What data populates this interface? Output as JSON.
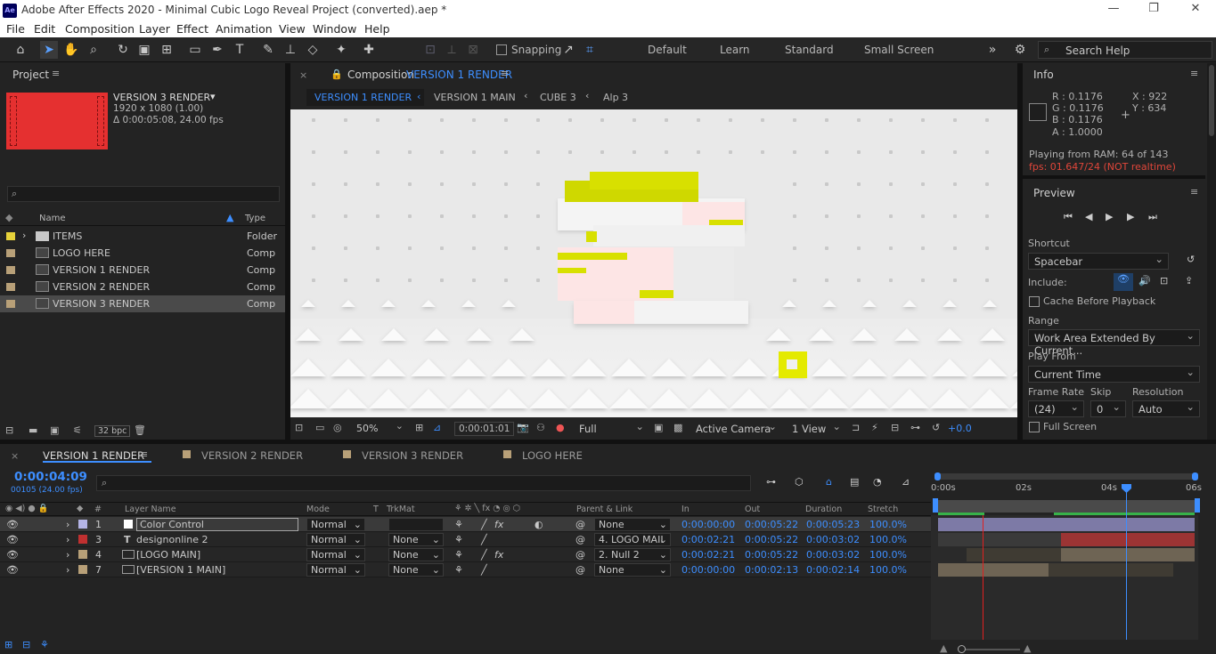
{
  "app": {
    "logo": "Ae",
    "title": "Adobe After Effects 2020 - Minimal Cubic Logo Reveal Project (converted).aep *"
  },
  "menu": [
    "File",
    "Edit",
    "Composition",
    "Layer",
    "Effect",
    "Animation",
    "View",
    "Window",
    "Help"
  ],
  "toolbar": {
    "snapping": "Snapping",
    "workspaces": [
      "Default",
      "Learn",
      "Standard",
      "Small Screen"
    ],
    "search_placeholder": "Search Help"
  },
  "project": {
    "title": "Project",
    "selected": {
      "name": "VERSION 3 RENDER",
      "size": "1920 x 1080 (1.00)",
      "duration": "Δ 0:00:05:08, 24.00 fps"
    },
    "col_name": "Name",
    "col_type": "Type",
    "bpc": "32 bpc",
    "items": [
      {
        "name": "ITEMS",
        "type": "Folder",
        "color": "#e6d23a"
      },
      {
        "name": "LOGO HERE",
        "type": "Comp",
        "color": "#b8a078"
      },
      {
        "name": "VERSION 1 RENDER",
        "type": "Comp",
        "color": "#b8a078"
      },
      {
        "name": "VERSION 2 RENDER",
        "type": "Comp",
        "color": "#b8a078"
      },
      {
        "name": "VERSION 3 RENDER",
        "type": "Comp",
        "color": "#b8a078"
      }
    ]
  },
  "comp": {
    "label": "Composition",
    "name": "VERSION 1 RENDER",
    "breadcrumbs": [
      "VERSION 1 RENDER",
      "VERSION 1 MAIN",
      "CUBE 3",
      "Alp 3"
    ],
    "footer": {
      "zoom": "50%",
      "time": "0:00:01:01",
      "quality": "Full",
      "camera": "Active Camera",
      "views": "1 View",
      "exposure": "+0.0"
    }
  },
  "info": {
    "title": "Info",
    "r": "R : 0.1176",
    "g": "G : 0.1176",
    "b": "B : 0.1176",
    "a": "A : 1.0000",
    "x": "X : 922",
    "y": "Y : 634",
    "ram": "Playing from RAM: 64 of 143",
    "fps": "fps: 01.647/24 (NOT realtime)"
  },
  "preview": {
    "title": "Preview",
    "shortcut_label": "Shortcut",
    "shortcut": "Spacebar",
    "include": "Include:",
    "cache": "Cache Before Playback",
    "range_label": "Range",
    "range": "Work Area Extended By Current...",
    "playfrom_label": "Play From",
    "playfrom": "Current Time",
    "framerate_label": "Frame Rate",
    "skip_label": "Skip",
    "resolution_label": "Resolution",
    "framerate": "(24)",
    "skip": "0",
    "resolution": "Auto",
    "fullscreen": "Full Screen"
  },
  "timeline": {
    "tabs": [
      "VERSION 1 RENDER",
      "VERSION 2 RENDER",
      "VERSION 3 RENDER",
      "LOGO HERE"
    ],
    "time": "0:00:04:09",
    "frame": "00105 (24.00 fps)",
    "headers": {
      "layer": "Layer Name",
      "mode": "Mode",
      "t": "T",
      "trkmat": "TrkMat",
      "parent": "Parent & Link",
      "in": "In",
      "out": "Out",
      "duration": "Duration",
      "stretch": "Stretch"
    },
    "ruler": [
      "0:00s",
      "02s",
      "04s",
      "06s"
    ],
    "layers": [
      {
        "num": "1",
        "color": "#b4b4e6",
        "name": "Color Control",
        "mode": "Normal",
        "trkmat": "",
        "parent": "None",
        "in": "0:00:00:00",
        "out": "0:00:05:22",
        "dur": "0:00:05:23",
        "stretch": "100.0%"
      },
      {
        "num": "3",
        "color": "#c03030",
        "name": "designonline 2",
        "mode": "Normal",
        "trkmat": "None",
        "parent": "4. LOGO MAII",
        "in": "0:00:02:21",
        "out": "0:00:05:22",
        "dur": "0:00:03:02",
        "stretch": "100.0%"
      },
      {
        "num": "4",
        "color": "#b8a078",
        "name": "[LOGO MAIN]",
        "mode": "Normal",
        "trkmat": "None",
        "parent": "2. Null 2",
        "in": "0:00:02:21",
        "out": "0:00:05:22",
        "dur": "0:00:03:02",
        "stretch": "100.0%"
      },
      {
        "num": "7",
        "color": "#b8a078",
        "name": "[VERSION 1 MAIN]",
        "mode": "Normal",
        "trkmat": "None",
        "parent": "None",
        "in": "0:00:00:00",
        "out": "0:00:02:13",
        "dur": "0:00:02:14",
        "stretch": "100.0%"
      }
    ]
  }
}
